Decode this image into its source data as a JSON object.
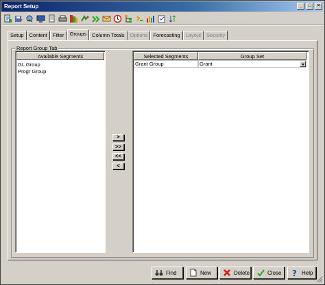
{
  "window": {
    "title": "Report Setup",
    "controls": [
      "_",
      "□",
      "×"
    ]
  },
  "toolbar": {
    "icons": [
      "new-report-icon",
      "save-icon",
      "copy-icon",
      "preview-icon",
      "print-icon",
      "print-setup-icon",
      "export-icon",
      "run-icon",
      "import-icon",
      "email-icon",
      "schedule-icon",
      "tree-icon",
      "refresh-icon",
      "chart-icon",
      "notes-icon",
      "sort-icon"
    ]
  },
  "tabs": [
    {
      "label": "Setup",
      "state": "normal"
    },
    {
      "label": "Content",
      "state": "normal"
    },
    {
      "label": "Filter",
      "state": "normal"
    },
    {
      "label": "Groups",
      "state": "active"
    },
    {
      "label": "Column Totals",
      "state": "normal"
    },
    {
      "label": "Options",
      "state": "disabled"
    },
    {
      "label": "Forecasting",
      "state": "normal"
    },
    {
      "label": "Layout",
      "state": "disabled"
    },
    {
      "label": "Security",
      "state": "disabled"
    }
  ],
  "group_tab": {
    "label": "Report Group Tab",
    "available": {
      "header": "Available Segments",
      "items": [
        "GL Group",
        "Progr Group"
      ]
    },
    "selected": {
      "headers": [
        "Selected Segments",
        "Group Set"
      ],
      "rows": [
        {
          "segment": "Grant Group",
          "group_set": "Grant"
        }
      ]
    },
    "move_buttons": [
      ">",
      ">>",
      "<<",
      "<"
    ]
  },
  "buttons": {
    "find": "Find",
    "new": "New",
    "delete": "Delete",
    "close": "Close",
    "help": "Help"
  },
  "colors": {
    "title_start": "#0a246a",
    "title_end": "#a6caf0",
    "face": "#d4d0c8"
  }
}
